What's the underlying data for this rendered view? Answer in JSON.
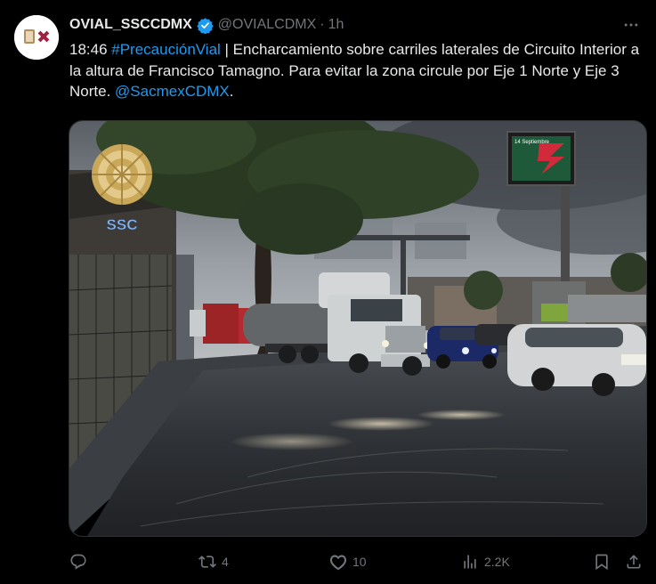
{
  "tweet": {
    "display_name": "OVIAL_SSCCDMX",
    "handle": "@OVIALCDMX",
    "separator": "·",
    "time": "1h",
    "text": {
      "part1": "18:46 ",
      "hashtag": "#PrecauciónVial",
      "part2": " | Encharcamiento sobre carriles laterales de Circuito Interior  a la altura de Francisco Tamagno. Para evitar la zona circule por Eje 1 Norte y Eje 3 Norte. ",
      "mention": "@SacmexCDMX",
      "part3": "."
    }
  },
  "media": {
    "badge_text": "SSC",
    "billboard_text": "14 Septiembre"
  },
  "actions": {
    "reply_count": "",
    "retweet_count": "4",
    "like_count": "10",
    "views_count": "2.2K"
  },
  "colors": {
    "link": "#1d9bf0",
    "verified": "#1d9bf0",
    "secondary_text": "#71767b"
  }
}
